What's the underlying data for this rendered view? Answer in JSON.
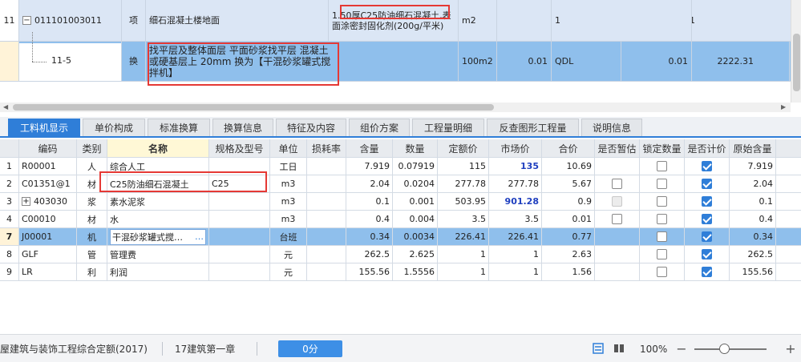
{
  "top_grid": {
    "row1": {
      "num": "11",
      "code": "011101003011",
      "type": "项",
      "name": "细石混凝土楼地面",
      "spec": "1.50厚C25防油细石混凝土,表面涂密封固化剂(200g/平米)",
      "unit": "m2",
      "qty": "1",
      "amount": "1"
    },
    "row2": {
      "code": "11-5",
      "type": "换",
      "name": "找平层及整体面层 平面砂浆找平层 混凝土或硬基层上 20mm 换为【干混砂浆罐式搅拌机】",
      "unit": "100m2",
      "qty": "0.01",
      "expr": "QDL",
      "qty2": "0.01",
      "price": "2222.31"
    }
  },
  "tabs": [
    "工料机显示",
    "单价构成",
    "标准换算",
    "换算信息",
    "特征及内容",
    "组价方案",
    "工程量明细",
    "反查图形工程量",
    "说明信息"
  ],
  "columns": [
    "编码",
    "类别",
    "名称",
    "规格及型号",
    "单位",
    "损耗率",
    "含量",
    "数量",
    "定额价",
    "市场价",
    "合价",
    "是否暂估",
    "锁定数量",
    "是否计价",
    "原始含量"
  ],
  "rows": [
    {
      "n": "1",
      "code": "R00001",
      "cat": "人",
      "name": "综合人工",
      "spec": "",
      "unit": "工日",
      "loss": "",
      "content": "7.919",
      "qty": "0.07919",
      "price": "115",
      "market": "135",
      "total": "10.69",
      "est": "none",
      "lock": "off",
      "charge": "on",
      "orig": "7.919"
    },
    {
      "n": "2",
      "code": "C01351@1",
      "cat": "材",
      "name": "C25防油细石混凝土",
      "spec": "C25",
      "unit": "m3",
      "loss": "",
      "content": "2.04",
      "qty": "0.0204",
      "price": "277.78",
      "market": "277.78",
      "total": "5.67",
      "est": "off",
      "lock": "off",
      "charge": "on",
      "orig": "2.04"
    },
    {
      "n": "3",
      "code": "403030",
      "cat": "浆",
      "name": "素水泥浆",
      "spec": "",
      "unit": "m3",
      "loss": "",
      "content": "0.1",
      "qty": "0.001",
      "price": "503.95",
      "market": "901.28",
      "total": "0.9",
      "est": "dis",
      "lock": "off",
      "charge": "on",
      "orig": "0.1"
    },
    {
      "n": "4",
      "code": "C00010",
      "cat": "材",
      "name": "水",
      "spec": "",
      "unit": "m3",
      "loss": "",
      "content": "0.4",
      "qty": "0.004",
      "price": "3.5",
      "market": "3.5",
      "total": "0.01",
      "est": "off",
      "lock": "off",
      "charge": "on",
      "orig": "0.4"
    },
    {
      "n": "7",
      "code": "J00001",
      "cat": "机",
      "name": "干混砂浆罐式搅…",
      "spec": "",
      "unit": "台班",
      "loss": "",
      "content": "0.34",
      "qty": "0.0034",
      "price": "226.41",
      "market": "226.41",
      "total": "0.77",
      "est": "none",
      "lock": "off",
      "charge": "on",
      "orig": "0.34"
    },
    {
      "n": "8",
      "code": "GLF",
      "cat": "管",
      "name": "管理费",
      "spec": "",
      "unit": "元",
      "loss": "",
      "content": "262.5",
      "qty": "2.625",
      "price": "1",
      "market": "1",
      "total": "2.63",
      "est": "none",
      "lock": "off",
      "charge": "on",
      "orig": "262.5"
    },
    {
      "n": "9",
      "code": "LR",
      "cat": "利",
      "name": "利润",
      "spec": "",
      "unit": "元",
      "loss": "",
      "content": "155.56",
      "qty": "1.5556",
      "price": "1",
      "market": "1",
      "total": "1.56",
      "est": "none",
      "lock": "off",
      "charge": "on",
      "orig": "155.56"
    }
  ],
  "name_edit_dots": "…",
  "status": {
    "quota": "屋建筑与装饰工程综合定额(2017)",
    "chapter": "17建筑第一章",
    "score": "0分",
    "zoom": "100%",
    "minus": "−",
    "plus": "+"
  },
  "colors": {
    "accent": "#2f7ed8",
    "selected_row": "#8fbfec",
    "highlight": "#e53935",
    "market_price": "#1f3fbf"
  }
}
